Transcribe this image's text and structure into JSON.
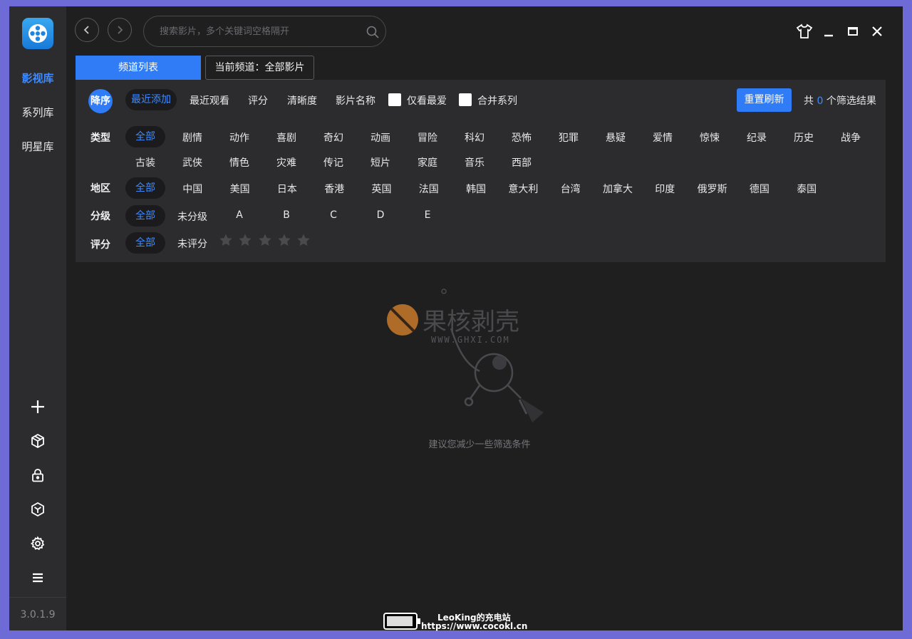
{
  "sidebar": {
    "nav": [
      {
        "label": "影视库",
        "active": true
      },
      {
        "label": "系列库",
        "active": false
      },
      {
        "label": "明星库",
        "active": false
      }
    ],
    "icons": [
      "plus-icon",
      "cube-open-icon",
      "lock-icon",
      "box-icon",
      "gear-icon",
      "menu-icon"
    ],
    "version": "3.0.1.9"
  },
  "header": {
    "search_placeholder": "搜索影片，多个关键词空格隔开"
  },
  "tabs": {
    "channel_list": "频道列表",
    "current_channel": "当前频道：全部影片"
  },
  "filters": {
    "sort_direction": "降序",
    "sort_options": [
      "最近添加",
      "最近观看",
      "评分",
      "清晰度",
      "影片名称"
    ],
    "sort_active": "最近添加",
    "checkbox_favorites": "仅看最爱",
    "checkbox_merge_series": "合并系列",
    "reset_button": "重置刷新",
    "result_prefix": "共",
    "result_count": "0",
    "result_suffix": "个筛选结果",
    "type_label": "类型",
    "types_row1": [
      "全部",
      "剧情",
      "动作",
      "喜剧",
      "奇幻",
      "动画",
      "冒险",
      "科幻",
      "恐怖",
      "犯罪",
      "悬疑",
      "爱情",
      "惊悚",
      "纪录",
      "历史",
      "战争"
    ],
    "types_row2": [
      "古装",
      "武侠",
      "情色",
      "灾难",
      "传记",
      "短片",
      "家庭",
      "音乐",
      "西部"
    ],
    "region_label": "地区",
    "regions": [
      "全部",
      "中国",
      "美国",
      "日本",
      "香港",
      "英国",
      "法国",
      "韩国",
      "意大利",
      "台湾",
      "加拿大",
      "印度",
      "俄罗斯",
      "德国",
      "泰国"
    ],
    "grade_label": "分级",
    "grades": [
      "全部",
      "未分级",
      "A",
      "B",
      "C",
      "D",
      "E"
    ],
    "rating_label": "评分",
    "ratings": [
      "全部",
      "未评分"
    ],
    "stars": 5
  },
  "empty_state": {
    "message": "建议您减少一些筛选条件",
    "watermark_text": "果核剥壳",
    "watermark_url": "WWW.GHXI.COM"
  },
  "footer_watermark": {
    "line1": "LeoKing的充电站",
    "line2": "https://www.cocokl.cn"
  },
  "colors": {
    "accent": "#2f7cf6",
    "background": "#1f1f20",
    "panel": "#2c2c2f",
    "frame": "#6e6ad6"
  }
}
